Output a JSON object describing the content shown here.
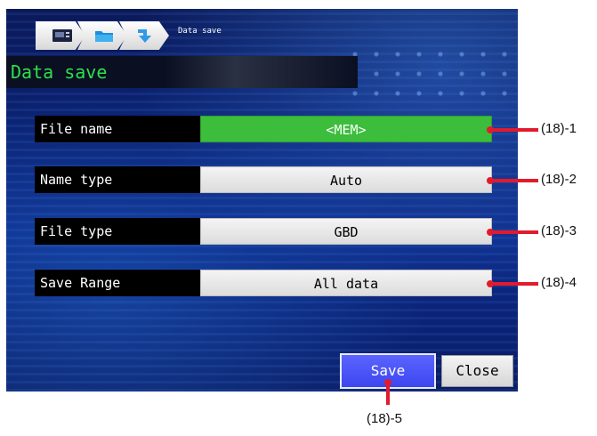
{
  "breadcrumb": {
    "current_label": "Data save",
    "items": [
      {
        "icon": "memory-card-icon"
      },
      {
        "icon": "folder-icon"
      },
      {
        "icon": "save-arrow-icon"
      }
    ]
  },
  "title": "Data save",
  "rows": [
    {
      "label": "File name",
      "value": "<MEM>",
      "callout": "(18)-1"
    },
    {
      "label": "Name type",
      "value": "Auto",
      "callout": "(18)-2"
    },
    {
      "label": "File type",
      "value": "GBD",
      "callout": "(18)-3"
    },
    {
      "label": "Save Range",
      "value": "All data",
      "callout": "(18)-4"
    }
  ],
  "buttons": {
    "save_label": "Save",
    "close_label": "Close",
    "save_callout": "(18)-5"
  },
  "colors": {
    "title_text": "#2ee04b",
    "selected_field": "#3cbd3c",
    "save_button": "#4a52f5",
    "callout": "#e21a2d",
    "background": "#0a1f6e"
  }
}
